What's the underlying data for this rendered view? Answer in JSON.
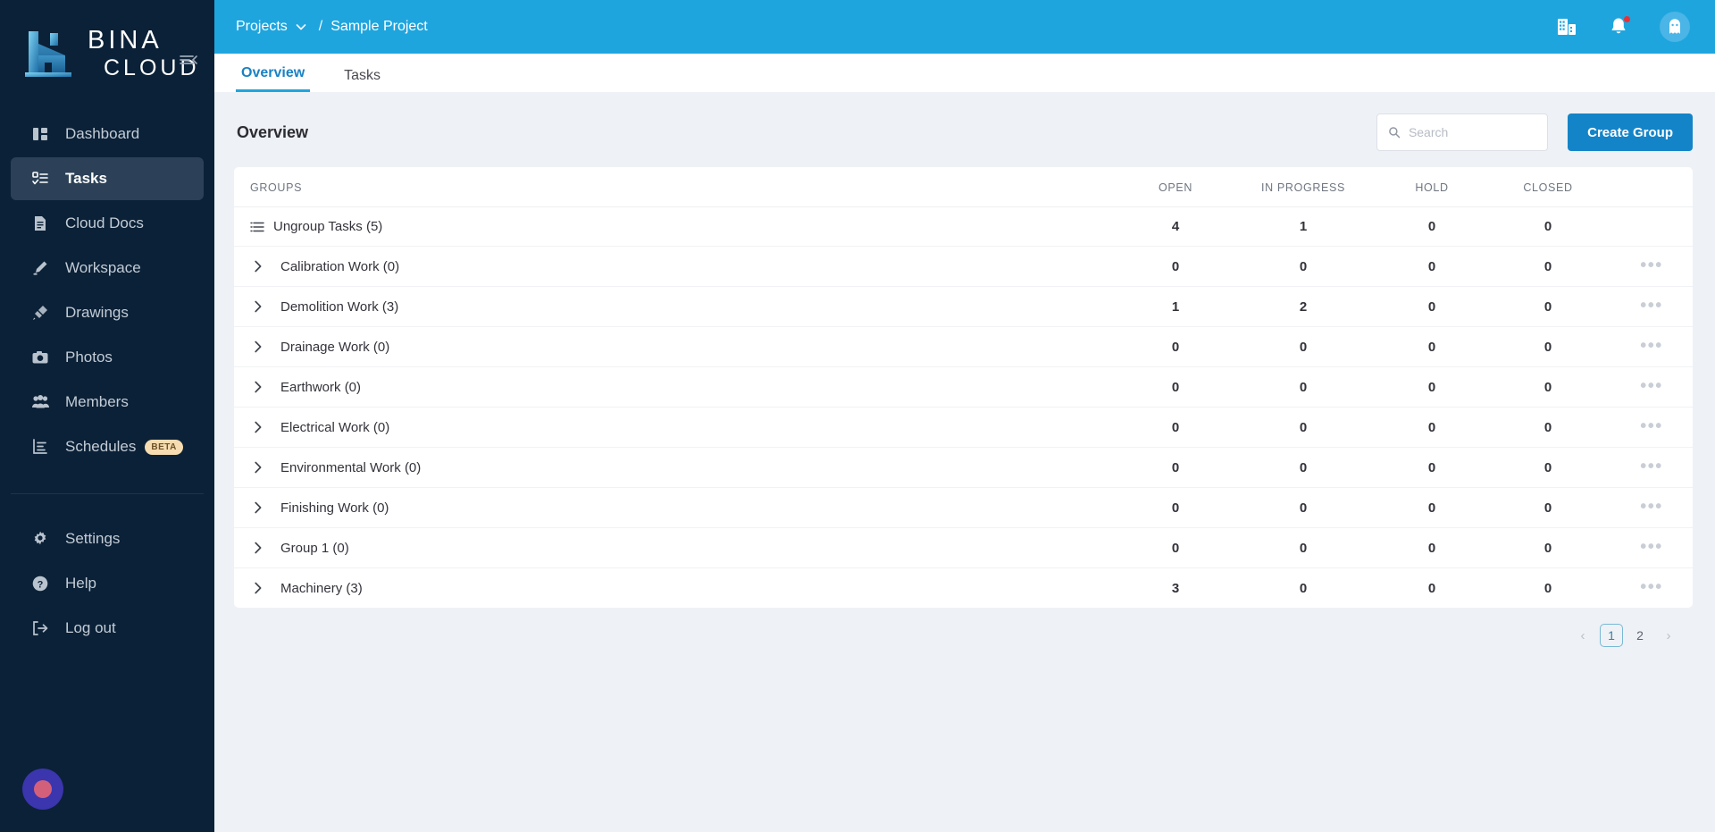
{
  "brand": {
    "line1": "BINA",
    "line2": "CLOUD",
    "logo_icon": "building-logo-icon",
    "collapse_icon": "collapse-sidebar-icon"
  },
  "sidebar": {
    "items": [
      {
        "label": "Dashboard",
        "icon": "dashboard-icon",
        "active": false
      },
      {
        "label": "Tasks",
        "icon": "tasks-checklist-icon",
        "active": true
      },
      {
        "label": "Cloud Docs",
        "icon": "document-icon",
        "active": false
      },
      {
        "label": "Workspace",
        "icon": "pen-workspace-icon",
        "active": false
      },
      {
        "label": "Drawings",
        "icon": "drawings-icon",
        "active": false
      },
      {
        "label": "Photos",
        "icon": "camera-icon",
        "active": false
      },
      {
        "label": "Members",
        "icon": "people-icon",
        "active": false
      },
      {
        "label": "Schedules",
        "icon": "schedule-chart-icon",
        "active": false,
        "badge": "BETA"
      }
    ],
    "bottom_items": [
      {
        "label": "Settings",
        "icon": "gear-icon"
      },
      {
        "label": "Help",
        "icon": "question-circle-icon"
      },
      {
        "label": "Log out",
        "icon": "logout-icon"
      }
    ],
    "support_widget": "support-bubble-button"
  },
  "header": {
    "breadcrumb": {
      "root": "Projects",
      "dropdown_icon": "chevron-down-icon",
      "separator": "/",
      "current": "Sample Project"
    },
    "icons": [
      {
        "name": "company-building-icon"
      },
      {
        "name": "notification-bell-icon",
        "has_dot": true
      },
      {
        "name": "user-avatar-ghost-icon"
      }
    ]
  },
  "tabs": [
    {
      "label": "Overview",
      "active": true
    },
    {
      "label": "Tasks",
      "active": false
    }
  ],
  "main": {
    "title": "Overview",
    "search": {
      "placeholder": "Search",
      "value": "",
      "icon": "search-icon"
    },
    "create_group_label": "Create Group",
    "columns": [
      "GROUPS",
      "OPEN",
      "IN PROGRESS",
      "HOLD",
      "CLOSED"
    ],
    "rows": [
      {
        "name": "Ungroup Tasks (5)",
        "icon": "list-lines-icon",
        "open": "4",
        "in_progress": "1",
        "hold": "0",
        "closed": "0",
        "menu": false
      },
      {
        "name": "Calibration Work (0)",
        "icon": "chevron-right-icon",
        "open": "0",
        "in_progress": "0",
        "hold": "0",
        "closed": "0",
        "menu": true
      },
      {
        "name": "Demolition Work (3)",
        "icon": "chevron-right-icon",
        "open": "1",
        "in_progress": "2",
        "hold": "0",
        "closed": "0",
        "menu": true
      },
      {
        "name": "Drainage Work (0)",
        "icon": "chevron-right-icon",
        "open": "0",
        "in_progress": "0",
        "hold": "0",
        "closed": "0",
        "menu": true
      },
      {
        "name": "Earthwork (0)",
        "icon": "chevron-right-icon",
        "open": "0",
        "in_progress": "0",
        "hold": "0",
        "closed": "0",
        "menu": true
      },
      {
        "name": "Electrical Work (0)",
        "icon": "chevron-right-icon",
        "open": "0",
        "in_progress": "0",
        "hold": "0",
        "closed": "0",
        "menu": true
      },
      {
        "name": "Environmental Work (0)",
        "icon": "chevron-right-icon",
        "open": "0",
        "in_progress": "0",
        "hold": "0",
        "closed": "0",
        "menu": true
      },
      {
        "name": "Finishing Work (0)",
        "icon": "chevron-right-icon",
        "open": "0",
        "in_progress": "0",
        "hold": "0",
        "closed": "0",
        "menu": true
      },
      {
        "name": "Group 1 (0)",
        "icon": "chevron-right-icon",
        "open": "0",
        "in_progress": "0",
        "hold": "0",
        "closed": "0",
        "menu": true
      },
      {
        "name": "Machinery (3)",
        "icon": "chevron-right-icon",
        "open": "3",
        "in_progress": "0",
        "hold": "0",
        "closed": "0",
        "menu": true
      }
    ],
    "pagination": {
      "prev": "‹",
      "pages": [
        "1",
        "2"
      ],
      "current": "1",
      "next": "›"
    }
  },
  "colors": {
    "brand_blue": "#1fa5de",
    "sidebar_navy": "#0b2137",
    "sidebar_active": "#2c4157",
    "primary_button": "#1484c8",
    "page_bg": "#eef1f5",
    "badge_beta": "#f6dcb0",
    "notification_dot": "#ec2f34"
  }
}
